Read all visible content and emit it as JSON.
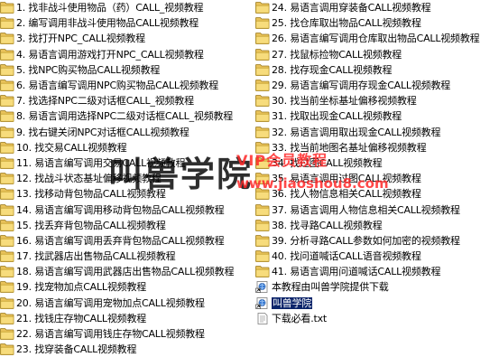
{
  "left_items": [
    {
      "label": "1. 找非战斗使用物品（药）CALL_视频教程",
      "icon": "folder-icon"
    },
    {
      "label": "2. 编写调用非战斗使用物品CALL视频教程",
      "icon": "folder-icon"
    },
    {
      "label": "3. 找打开NPC_CALL视频教程",
      "icon": "folder-icon"
    },
    {
      "label": "4. 易语言调用游戏打开NPC_CALL视频教程",
      "icon": "folder-icon"
    },
    {
      "label": "5. 找NPC购买物品CALL视频教程",
      "icon": "folder-icon"
    },
    {
      "label": "6. 易语言编写调用NPC购买物品CALL视频教程",
      "icon": "folder-icon"
    },
    {
      "label": "7. 找选择NPC二级对话框CALL_视频教程",
      "icon": "folder-icon"
    },
    {
      "label": "8. 易语言调用选择NPC二级对话框CALL_视频教程",
      "icon": "folder-icon"
    },
    {
      "label": "9. 找右键关闭NPC对话框CALL视频教程",
      "icon": "folder-icon"
    },
    {
      "label": "10. 找交易CALL视频教程",
      "icon": "folder-icon"
    },
    {
      "label": "11. 易语言编写调用交易CALL视频教程",
      "icon": "folder-icon"
    },
    {
      "label": "12. 找战斗状态基址偏移视频教程",
      "icon": "folder-icon"
    },
    {
      "label": "13. 找移动背包物品CALL视频教程",
      "icon": "folder-icon"
    },
    {
      "label": "14. 易语言编写调用移动背包物品CALL视频教程",
      "icon": "folder-icon"
    },
    {
      "label": "15. 找丢弃背包物品CALL视频教程",
      "icon": "folder-icon"
    },
    {
      "label": "16. 易语言编写调用丢弃背包物品CALL视频教程",
      "icon": "folder-icon"
    },
    {
      "label": "17. 找武器店出售物品CALL视频教程",
      "icon": "folder-icon"
    },
    {
      "label": "18. 易语言编写调用武器店出售物品CALL视频教程",
      "icon": "folder-icon"
    },
    {
      "label": "19. 找宠物加点CALL视频教程",
      "icon": "folder-icon"
    },
    {
      "label": "20. 易语言编写调用宠物加点CALL视频教程",
      "icon": "folder-icon"
    },
    {
      "label": "21. 找钱庄存物CALL视频教程",
      "icon": "folder-icon"
    },
    {
      "label": "22. 易语言编写调用钱庄存物CALL视频教程",
      "icon": "folder-icon"
    },
    {
      "label": "23. 找穿装备CALL视频教程",
      "icon": "folder-icon"
    }
  ],
  "right_items": [
    {
      "label": "24. 易语言调用穿装备CALL视频教程",
      "icon": "folder-icon"
    },
    {
      "label": "25. 找仓库取出物品CALL视频教程",
      "icon": "folder-icon"
    },
    {
      "label": "26. 易语言编写调用仓库取出物品CALL视频教程",
      "icon": "folder-icon"
    },
    {
      "label": "27. 找鼠标捡物CALL视频教程",
      "icon": "folder-icon"
    },
    {
      "label": "28. 找存现金CALL视频教程",
      "icon": "folder-icon"
    },
    {
      "label": "29. 易语言编写调用存现金CALL视频教程",
      "icon": "folder-icon"
    },
    {
      "label": "30. 找当前坐标基址偏移视频教程",
      "icon": "folder-icon"
    },
    {
      "label": "31. 找取出现金CALL视频教程",
      "icon": "folder-icon"
    },
    {
      "label": "32. 易语言调用取出现金CALL视频教程",
      "icon": "folder-icon"
    },
    {
      "label": "33. 找当前地图名基址偏移视频教程",
      "icon": "folder-icon"
    },
    {
      "label": "34. 找过图CALL视频教程",
      "icon": "folder-icon"
    },
    {
      "label": "35. 易语言调用过图CALL视频教程",
      "icon": "folder-icon"
    },
    {
      "label": "36. 找人物信息相关CALL视频教程",
      "icon": "folder-icon"
    },
    {
      "label": "37. 易语言调用人物信息相关CALL视频教程",
      "icon": "folder-icon"
    },
    {
      "label": "38. 找寻路CALL视频教程",
      "icon": "folder-icon"
    },
    {
      "label": "39. 分析寻路CALL参数如何加密的视频教程",
      "icon": "folder-icon"
    },
    {
      "label": "40. 找问道喊话CALL语音视频教程",
      "icon": "folder-icon"
    },
    {
      "label": "41. 易语言调用问道喊话CALL视频教程",
      "icon": "folder-icon"
    },
    {
      "label": "本教程由叫兽学院提供下载",
      "icon": "internet-shortcut-icon"
    },
    {
      "label": "叫兽学院",
      "icon": "internet-shortcut-icon",
      "selected": true
    },
    {
      "label": "下载必看.txt",
      "icon": "text-file-icon"
    }
  ],
  "watermark": {
    "chinese": "叫兽学院",
    "vip": "VIP会员教程",
    "url": "www.jiaoshou8.com"
  }
}
